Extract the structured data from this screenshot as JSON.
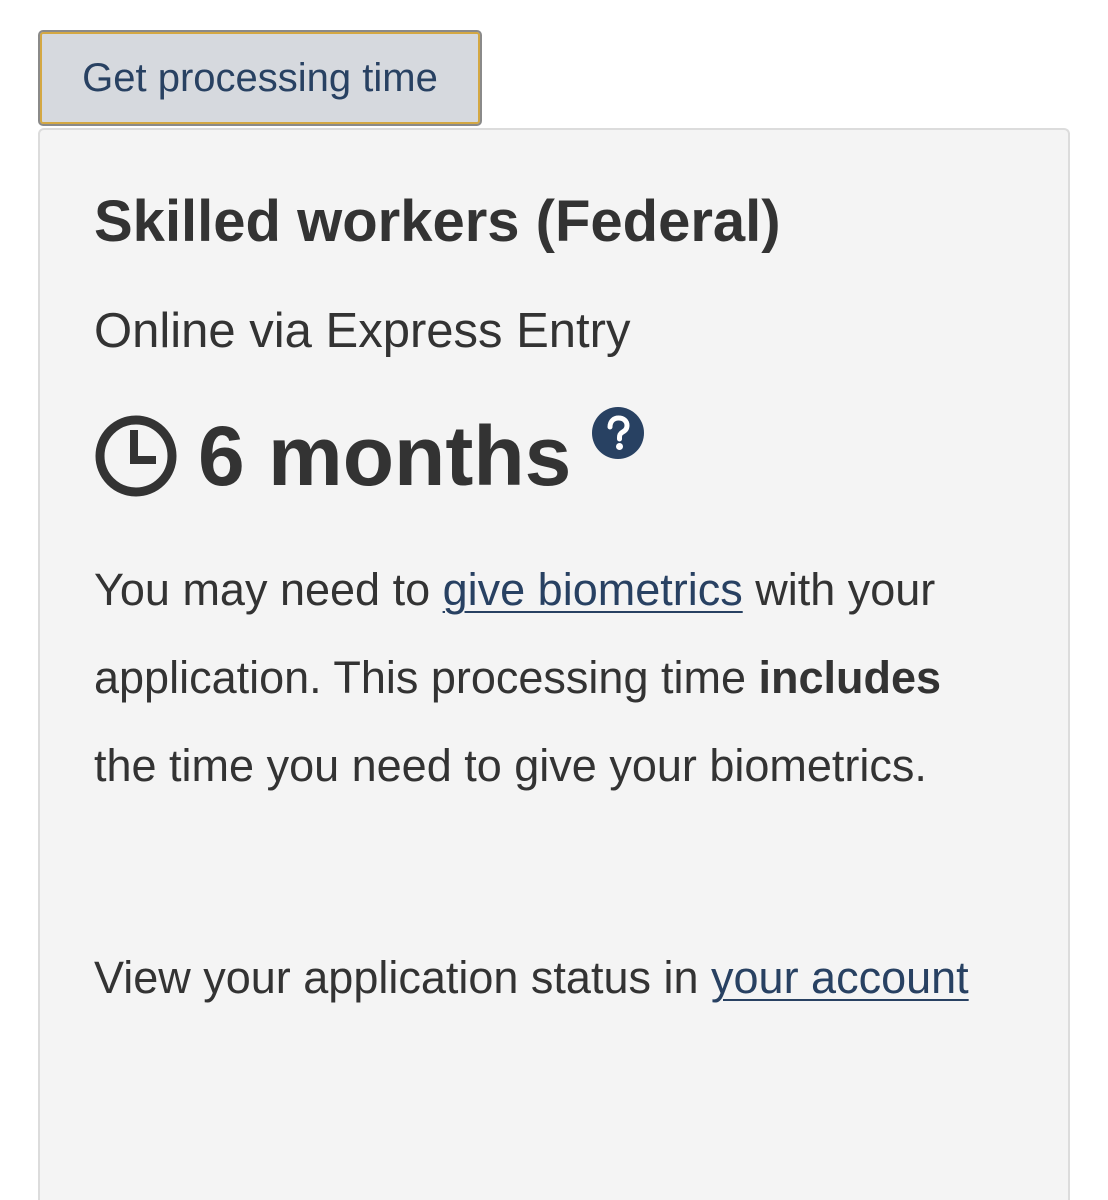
{
  "form": {
    "submit_label": "Get processing time"
  },
  "result": {
    "title": "Skilled workers (Federal)",
    "subtitle": "Online via Express Entry",
    "time_value": "6 months",
    "time_icon": "clock-icon",
    "help_icon": "question-circle-icon",
    "biometrics": {
      "text_before": "You may need to ",
      "link_label": "give biometrics",
      "text_after": " with your application. This processing time ",
      "emphasis": "includes",
      "text_end": " the time you need to give your biometrics."
    },
    "status": {
      "text_before": "View your application status in ",
      "link_label": "your account"
    }
  },
  "colors": {
    "link": "#284162",
    "button_bg": "#d6d9de",
    "button_focus": "#d4a843",
    "panel_bg": "#f4f4f4",
    "text": "#333333"
  }
}
